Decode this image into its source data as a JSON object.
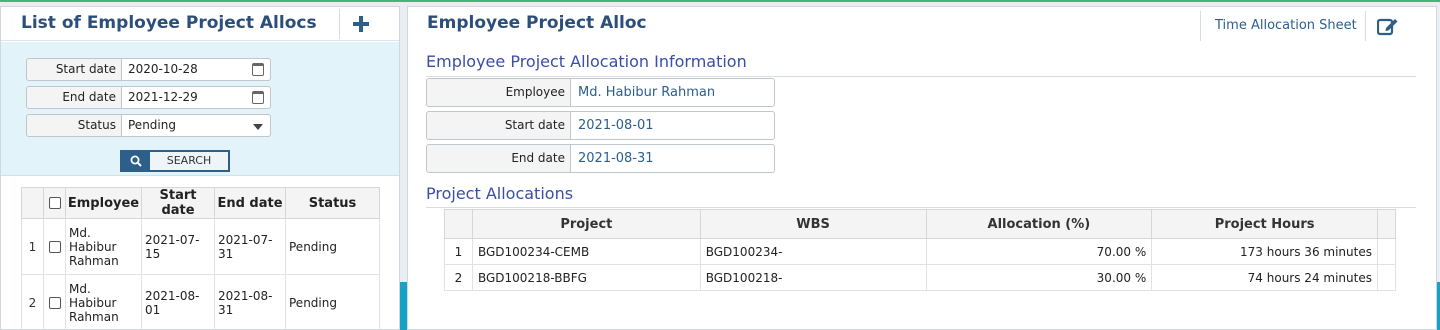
{
  "left_panel": {
    "title": "List of Employee Project Allocs",
    "filters": {
      "start_date_label": "Start date",
      "start_date_value": "2020-10-28",
      "end_date_label": "End date",
      "end_date_value": "2021-12-29",
      "status_label": "Status",
      "status_value": "Pending",
      "search_label": "SEARCH"
    },
    "table": {
      "headers": [
        "Employee",
        "Start date",
        "End date",
        "Status"
      ],
      "rows": [
        {
          "num": "1",
          "employee": "Md. Habibur Rahman",
          "start": "2021-07-15",
          "end": "2021-07-31",
          "status": "Pending"
        },
        {
          "num": "2",
          "employee": "Md. Habibur Rahman",
          "start": "2021-08-01",
          "end": "2021-08-31",
          "status": "Pending"
        }
      ]
    }
  },
  "right_panel": {
    "title": "Employee Project Alloc",
    "time_allocation_sheet": "Time Allocation Sheet",
    "info_section_title": "Employee Project Allocation Information",
    "fields": {
      "employee_label": "Employee",
      "employee_value": "Md. Habibur Rahman",
      "start_date_label": "Start date",
      "start_date_value": "2021-08-01",
      "end_date_label": "End date",
      "end_date_value": "2021-08-31"
    },
    "allocations_section_title": "Project Allocations",
    "allocations": {
      "headers": [
        "Project",
        "WBS",
        "Allocation (%)",
        "Project Hours"
      ],
      "rows": [
        {
          "num": "1",
          "project": "BGD100234-CEMB",
          "wbs": "BGD100234-",
          "allocation": "70.00 %",
          "hours": "173 hours 36 minutes"
        },
        {
          "num": "2",
          "project": "BGD100218-BBFG",
          "wbs": "BGD100218-",
          "allocation": "30.00 %",
          "hours": "74 hours 24 minutes"
        }
      ]
    }
  },
  "colors": {
    "title": "#2b4f7a",
    "section_title": "#3a4da8",
    "accent": "#14a3c4",
    "top_line": "#3cb878"
  }
}
